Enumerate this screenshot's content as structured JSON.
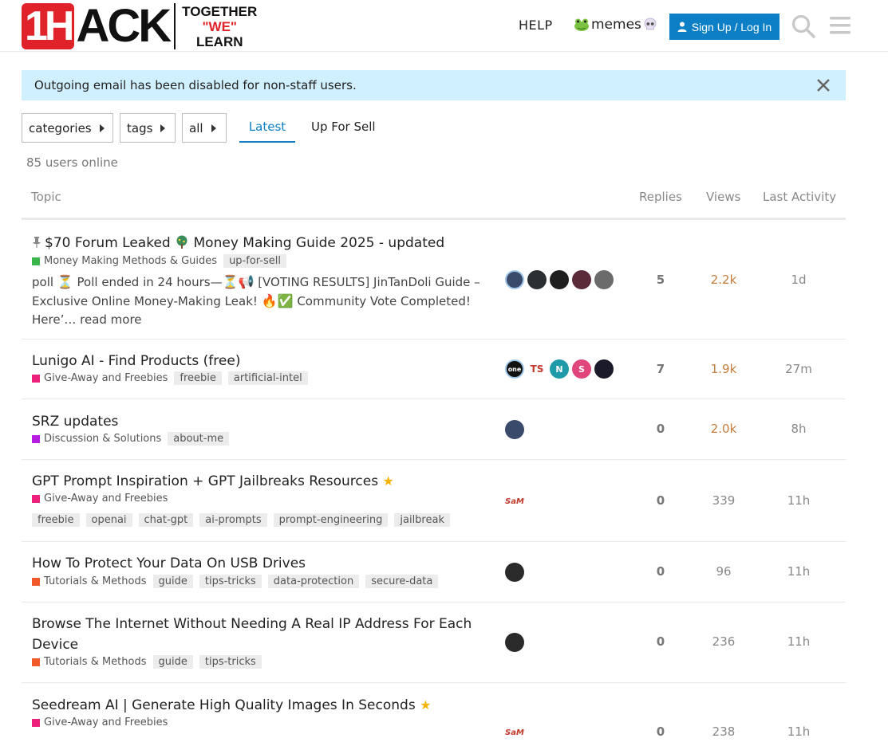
{
  "header": {
    "logo_badge": "1H",
    "logo_text": "ACK",
    "tagline": [
      "TOGETHER",
      "\"WE\"",
      "LEARN"
    ],
    "nav_help": "HELP",
    "nav_memes": "memes",
    "signup_label": "Sign Up / Log In"
  },
  "alert": {
    "text": "Outgoing email has been disabled for non-staff users."
  },
  "filters": {
    "categories": "categories",
    "tags": "tags",
    "all": "all",
    "tab_latest": "Latest",
    "tab_upforsell": "Up For Sell"
  },
  "users_online": "85 users online",
  "columns": {
    "topic": "Topic",
    "replies": "Replies",
    "views": "Views",
    "activity": "Last Activity"
  },
  "topics": [
    {
      "title": "$70 Forum Leaked",
      "title_tail": "Money Making Guide 2025 - updated",
      "category": "Money Making Methods & Guides",
      "category_color": "#3ab54a",
      "tags": [
        "up-for-sell"
      ],
      "excerpt_a": "poll",
      "excerpt_b": "Poll ended in 24 hours—",
      "excerpt_c": "[VOTING RESULTS] JinTanDoli Guide – Exclusive Online Money-Making Leak!",
      "excerpt_d": "Community Vote Completed! Here’…",
      "read_more": "read more",
      "replies": "5",
      "views": "2.2k",
      "activity": "1d"
    },
    {
      "title": "Lunigo AI - Find Products (free)",
      "category": "Give-Away and Freebies",
      "category_color": "#ed207b",
      "tags": [
        "freebie",
        "artificial-intel"
      ],
      "avatar_letters": [
        "one",
        "TS",
        "N",
        "S"
      ],
      "replies": "7",
      "views": "1.9k",
      "activity": "27m"
    },
    {
      "title": "SRZ updates",
      "category": "Discussion & Solutions",
      "category_color": "#b71de0",
      "tags": [
        "about-me"
      ],
      "replies": "0",
      "views": "2.0k",
      "activity": "8h"
    },
    {
      "title": "GPT Prompt Inspiration + GPT Jailbreaks Resources",
      "category": "Give-Away and Freebies",
      "category_color": "#ed207b",
      "tags": [
        "freebie",
        "openai",
        "chat-gpt",
        "ai-prompts",
        "prompt-engineering",
        "jailbreak"
      ],
      "avatar_letters": [
        "SaM"
      ],
      "replies": "0",
      "views": "339",
      "activity": "11h"
    },
    {
      "title": "How To Protect Your Data On USB Drives",
      "category": "Tutorials & Methods",
      "category_color": "#f1592a",
      "tags": [
        "guide",
        "tips-tricks",
        "data-protection",
        "secure-data"
      ],
      "replies": "0",
      "views": "96",
      "activity": "11h"
    },
    {
      "title": "Browse The Internet Without Needing A Real IP Address For Each Device",
      "category": "Tutorials & Methods",
      "category_color": "#f1592a",
      "tags": [
        "guide",
        "tips-tricks"
      ],
      "replies": "0",
      "views": "236",
      "activity": "11h"
    },
    {
      "title": "Seedream AI | Generate High Quality Images In Seconds",
      "category": "Give-Away and Freebies",
      "category_color": "#ed207b",
      "avatar_letters": [
        "SaM"
      ],
      "replies": "0",
      "views": "238",
      "activity": "11h"
    }
  ],
  "colors": {
    "accent": "#0c7fc6",
    "alert_bg": "#d1f0ff",
    "hot_views": "#c47d3d",
    "brand_red": "#e0232a"
  }
}
